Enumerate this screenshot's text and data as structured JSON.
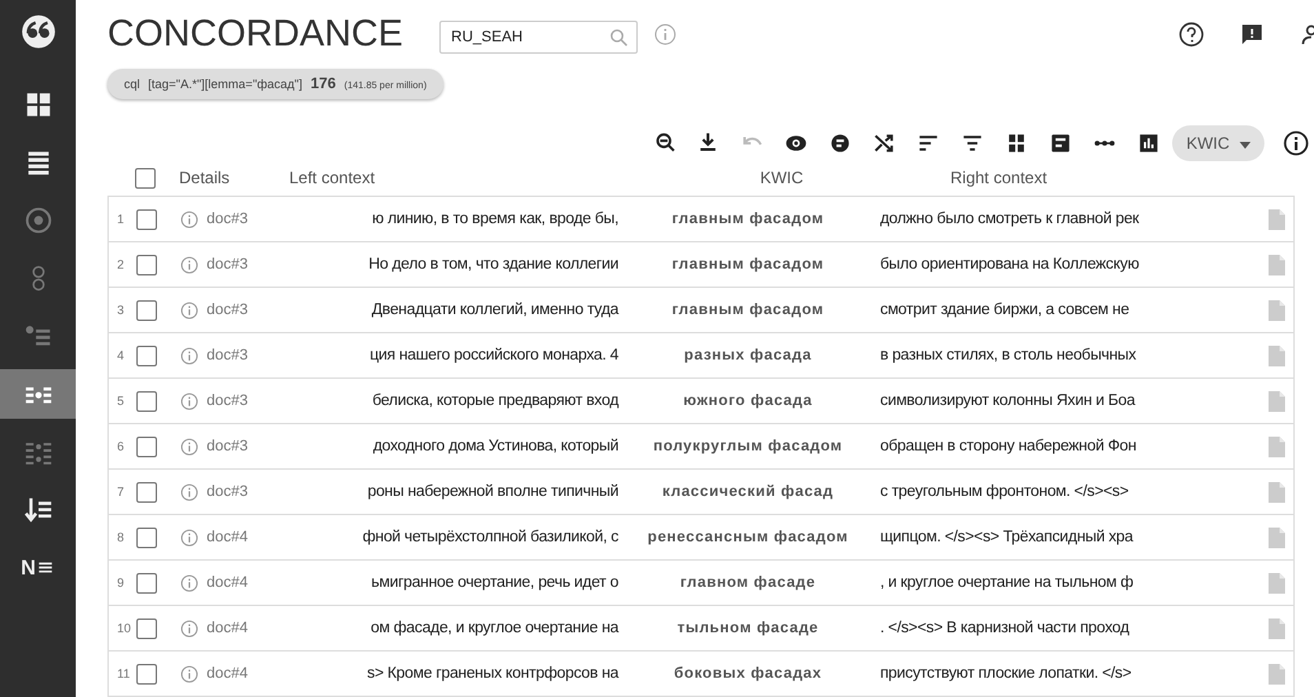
{
  "sidebar": {
    "items": [
      {
        "kind": "grid",
        "selected": false
      },
      {
        "kind": "list",
        "selected": false
      },
      {
        "kind": "target",
        "selected": false
      },
      {
        "kind": "circles",
        "selected": false
      },
      {
        "kind": "dotlist",
        "selected": false
      },
      {
        "kind": "kwic",
        "selected": true
      },
      {
        "kind": "kwic2",
        "selected": false
      },
      {
        "kind": "sort",
        "selected": false
      },
      {
        "kind": "ne",
        "selected": false,
        "label": "N"
      }
    ]
  },
  "header": {
    "title": "CONCORDANCE",
    "corpus": "RU_SEAH"
  },
  "query": {
    "type": "cql",
    "text": "[tag=\"A.*\"][lemma=\"фасад\"]",
    "count": "176",
    "rate": "(141.85 per million)"
  },
  "toolbar": {
    "tools": [
      {
        "kind": "zoom-out",
        "disabled": false
      },
      {
        "kind": "download",
        "disabled": false
      },
      {
        "kind": "undo",
        "disabled": true
      },
      {
        "kind": "eye",
        "disabled": false
      },
      {
        "kind": "gdex",
        "disabled": false
      },
      {
        "kind": "shuffle",
        "disabled": false
      },
      {
        "kind": "sort",
        "disabled": false
      },
      {
        "kind": "filter",
        "disabled": false
      },
      {
        "kind": "grid",
        "disabled": false
      },
      {
        "kind": "save",
        "disabled": false
      },
      {
        "kind": "dots",
        "disabled": false
      },
      {
        "kind": "chart",
        "disabled": false
      }
    ],
    "view": "KWIC"
  },
  "table": {
    "select_all_checked": false,
    "columns": [
      "Details",
      "Left context",
      "KWIC",
      "Right context"
    ],
    "rows": [
      {
        "n": "1",
        "doc": "doc#3",
        "left": "ю линию, в то время как, вроде бы,",
        "kwic": "главным фасадом",
        "right": "должно было смотреть к главной рек",
        "checked": false
      },
      {
        "n": "2",
        "doc": "doc#3",
        "left": "Но дело в том, что здание коллегии",
        "kwic": "главным фасадом",
        "right": "было ориентирована на Коллежскую",
        "checked": false
      },
      {
        "n": "3",
        "doc": "doc#3",
        "left": "Двенадцати коллегий, именно туда",
        "kwic": "главным фасадом",
        "right": "смотрит здание биржи, а совсем не",
        "checked": false
      },
      {
        "n": "4",
        "doc": "doc#3",
        "left": "ция нашего российского монарха. 4",
        "kwic": "разных фасада",
        "right": "в разных стилях, в столь необычных",
        "checked": false
      },
      {
        "n": "5",
        "doc": "doc#3",
        "left": "белиска, которые предваряют вход",
        "kwic": "южного фасада",
        "right": "символизируют колонны Яхин и Боа",
        "checked": false
      },
      {
        "n": "6",
        "doc": "doc#3",
        "left": "доходного дома Устинова, который",
        "kwic": "полукруглым фасадом",
        "right": "обращен в сторону набережной Фон",
        "checked": false
      },
      {
        "n": "7",
        "doc": "doc#3",
        "left": "роны набережной вполне типичный",
        "kwic": "классический фасад",
        "right": "с треугольным фронтоном. </s><s>",
        "checked": false
      },
      {
        "n": "8",
        "doc": "doc#4",
        "left": "фной четырёхстолпной базиликой, с",
        "kwic": "ренессансным фасадом",
        "right": "щипцом. </s><s> Трёхапсидный хра",
        "checked": false
      },
      {
        "n": "9",
        "doc": "doc#4",
        "left": "ьмигранное очертание, речь идет о",
        "kwic": "главном фасаде",
        "right": ", и круглое очертание на тыльном ф",
        "checked": false
      },
      {
        "n": "10",
        "doc": "doc#4",
        "left": "ом фасаде, и круглое очертание на",
        "kwic": "тыльном фасаде",
        "right": ". </s><s> В карнизной части проход",
        "checked": false
      },
      {
        "n": "11",
        "doc": "doc#4",
        "left": "s> Кроме граненых контрфорсов на",
        "kwic": "боковых фасадах",
        "right": "присутствуют плоские лопатки. </s>",
        "checked": false
      }
    ]
  }
}
